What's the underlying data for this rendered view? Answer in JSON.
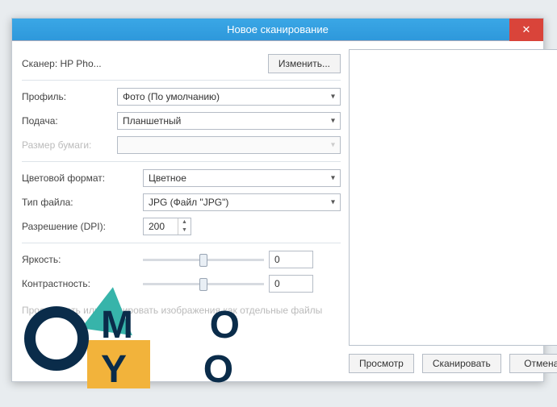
{
  "title": "Новое сканирование",
  "scanner": {
    "label": "Сканер: HP Pho...",
    "change_btn": "Изменить..."
  },
  "labels": {
    "profile": "Профиль:",
    "feed": "Подача:",
    "paper": "Размер бумаги:",
    "color": "Цветовой формат:",
    "filetype": "Тип файла:",
    "dpi": "Разрешение (DPI):",
    "brightness": "Яркость:",
    "contrast": "Контрастность:"
  },
  "values": {
    "profile": "Фото (По умолчанию)",
    "feed": "Планшетный",
    "paper": "",
    "color": "Цветное",
    "filetype": "JPG (Файл \"JPG\")",
    "dpi": "200",
    "brightness": "0",
    "contrast": "0"
  },
  "checkbox_text": "Просмотреть или сканировать изображения как отдельные файлы",
  "buttons": {
    "preview": "Просмотр",
    "scan": "Сканировать",
    "cancel": "Отмена"
  },
  "watermark": {
    "m": "M",
    "o": "O",
    "y": "Y",
    "o2": "O"
  }
}
